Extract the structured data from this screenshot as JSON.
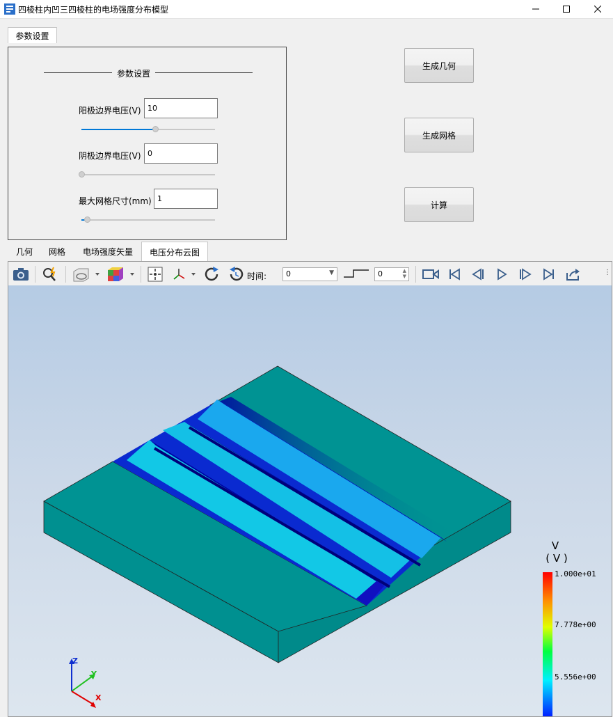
{
  "window": {
    "title": "四棱柱内凹三四棱柱的电场强度分布模型",
    "minimize_icon": "minimize-icon",
    "maximize_icon": "maximize-icon",
    "close_icon": "close-icon"
  },
  "params_tab": {
    "label": "参数设置"
  },
  "params_panel": {
    "group_title": "参数设置",
    "fields": [
      {
        "label": "阳极边界电压(V)",
        "value": "10",
        "slider_fraction": 0.55
      },
      {
        "label": "阴极边界电压(V)",
        "value": "0",
        "slider_fraction": 0.0
      },
      {
        "label": "最大网格尺寸(mm)",
        "value": "1",
        "slider_fraction": 0.04
      }
    ]
  },
  "actions": {
    "generate_geometry": "生成几何",
    "generate_mesh": "生成网格",
    "compute": "计算"
  },
  "view_tabs": [
    {
      "label": "几何",
      "active": false
    },
    {
      "label": "网格",
      "active": false
    },
    {
      "label": "电场强度矢量",
      "active": false
    },
    {
      "label": "电压分布云图",
      "active": true
    }
  ],
  "toolbar": {
    "time_label": "时间:",
    "time_select_value": "0",
    "time_spin_value": "0",
    "icons": [
      "camera-icon",
      "zoom-icon",
      "display-mode-icon",
      "color-cube-icon",
      "fit-view-icon",
      "axes-icon",
      "rotate-cw-icon",
      "rotate-ccw-icon",
      "video-icon",
      "first-frame-icon",
      "prev-frame-icon",
      "play-icon",
      "next-frame-icon",
      "last-frame-icon",
      "export-icon"
    ]
  },
  "legend": {
    "title": "V",
    "unit": "( V )",
    "ticks": [
      "1.000e+01",
      "7.778e+00",
      "5.556e+00"
    ]
  },
  "axes": {
    "z": "Z",
    "y": "Y",
    "x": "X"
  },
  "colors": {
    "accent": "#0078d7",
    "surface": "#009090",
    "field_low": "#0000c8",
    "field_high": "#ff0000"
  }
}
